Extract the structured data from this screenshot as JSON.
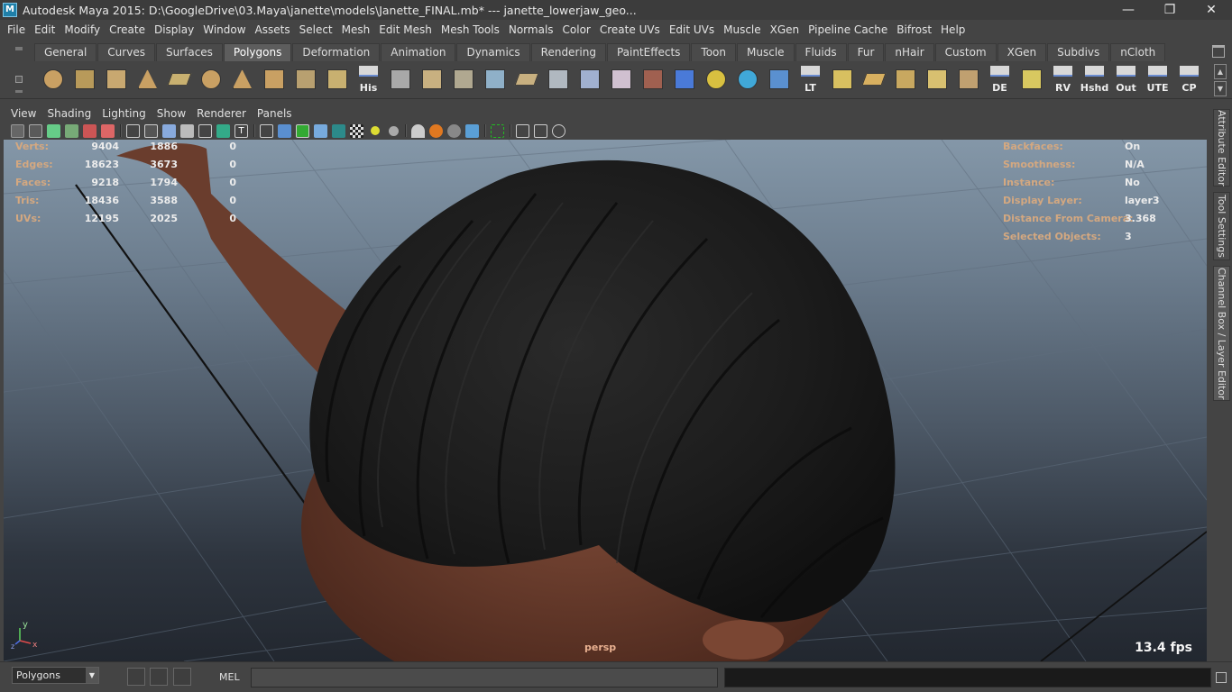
{
  "window": {
    "title": "Autodesk Maya 2015: D:\\GoogleDrive\\03.Maya\\janette\\models\\Janette_FINAL.mb*   ---   janette_lowerjaw_geo...",
    "minimize_icon": "minimize-icon",
    "restore_icon": "restore-icon",
    "close_icon": "close-icon"
  },
  "menubar": [
    "File",
    "Edit",
    "Modify",
    "Create",
    "Display",
    "Window",
    "Assets",
    "Select",
    "Mesh",
    "Edit Mesh",
    "Mesh Tools",
    "Normals",
    "Color",
    "Create UVs",
    "Edit UVs",
    "Muscle",
    "XGen",
    "Pipeline Cache",
    "Bifrost",
    "Help"
  ],
  "shelf": {
    "tabs": [
      "General",
      "Curves",
      "Surfaces",
      "Polygons",
      "Deformation",
      "Animation",
      "Dynamics",
      "Rendering",
      "PaintEffects",
      "Toon",
      "Muscle",
      "Fluids",
      "Fur",
      "nHair",
      "Custom",
      "XGen",
      "Subdivs",
      "nCloth"
    ],
    "active_tab": "Polygons",
    "icons": [
      {
        "name": "poly-sphere-icon",
        "label": ""
      },
      {
        "name": "poly-cube-icon",
        "label": ""
      },
      {
        "name": "poly-cylinder-icon",
        "label": ""
      },
      {
        "name": "poly-cone-icon",
        "label": ""
      },
      {
        "name": "poly-plane-icon",
        "label": ""
      },
      {
        "name": "poly-torus-icon",
        "label": ""
      },
      {
        "name": "poly-pyramid-icon",
        "label": ""
      },
      {
        "name": "poly-pipe-icon",
        "label": ""
      },
      {
        "name": "create-polygon-tool-icon",
        "label": ""
      },
      {
        "name": "append-polygon-icon",
        "label": ""
      },
      {
        "name": "history-icon",
        "label": "His"
      },
      {
        "name": "extrude-icon",
        "label": ""
      },
      {
        "name": "bridge-icon",
        "label": ""
      },
      {
        "name": "combine-icon",
        "label": ""
      },
      {
        "name": "separate-icon",
        "label": ""
      },
      {
        "name": "merge-icon",
        "label": ""
      },
      {
        "name": "bevel-icon",
        "label": ""
      },
      {
        "name": "split-icon",
        "label": ""
      },
      {
        "name": "sculpt-icon",
        "label": ""
      },
      {
        "name": "paint-tool-icon",
        "label": ""
      },
      {
        "name": "wireframe-cube-icon",
        "label": ""
      },
      {
        "name": "transform-gizmo-icon",
        "label": ""
      },
      {
        "name": "rotate-gizmo-icon",
        "label": ""
      },
      {
        "name": "move-pivot-icon",
        "label": ""
      },
      {
        "name": "lattice-icon",
        "label": "LT"
      },
      {
        "name": "uv-layout-icon",
        "label": ""
      },
      {
        "name": "uv-unfold-icon",
        "label": ""
      },
      {
        "name": "uv-select-icon",
        "label": ""
      },
      {
        "name": "uv-project-icon",
        "label": ""
      },
      {
        "name": "uv-cut-icon",
        "label": ""
      },
      {
        "name": "display-edge-icon",
        "label": "DE"
      },
      {
        "name": "uv-grid-icon",
        "label": ""
      },
      {
        "name": "rv-icon",
        "label": "RV"
      },
      {
        "name": "hshd-icon",
        "label": "Hshd"
      },
      {
        "name": "out-icon",
        "label": "Out"
      },
      {
        "name": "ute-icon",
        "label": "UTE"
      },
      {
        "name": "cp-icon",
        "label": "CP"
      }
    ]
  },
  "panel": {
    "menu": [
      "View",
      "Shading",
      "Lighting",
      "Show",
      "Renderer",
      "Panels"
    ],
    "camera": "persp",
    "fps": "13.4 fps",
    "axis": {
      "y": "y",
      "x": "x",
      "z": "z"
    }
  },
  "hud": {
    "stats": [
      {
        "label": "Verts:",
        "values": [
          "9404",
          "1886",
          "0"
        ]
      },
      {
        "label": "Edges:",
        "values": [
          "18623",
          "3673",
          "0"
        ]
      },
      {
        "label": "Faces:",
        "values": [
          "9218",
          "1794",
          "0"
        ]
      },
      {
        "label": "Tris:",
        "values": [
          "18436",
          "3588",
          "0"
        ]
      },
      {
        "label": "UVs:",
        "values": [
          "12195",
          "2025",
          "0"
        ]
      }
    ],
    "info": [
      {
        "label": "Backfaces:",
        "value": "On"
      },
      {
        "label": "Smoothness:",
        "value": "N/A"
      },
      {
        "label": "Instance:",
        "value": "No"
      },
      {
        "label": "Display Layer:",
        "value": "layer3"
      },
      {
        "label": "Distance From Camera:",
        "value": "3.368"
      },
      {
        "label": "Selected Objects:",
        "value": "3"
      }
    ]
  },
  "right_tabs": [
    "Attribute Editor",
    "Tool Settings",
    "Channel Box / Layer Editor"
  ],
  "bottom": {
    "mode": "Polygons",
    "script_type": "MEL",
    "command_value": "",
    "result_value": ""
  },
  "colors": {
    "hud_label": "#d4a880",
    "hair": "#1c1c1c",
    "skin": "#6b3d2d"
  }
}
